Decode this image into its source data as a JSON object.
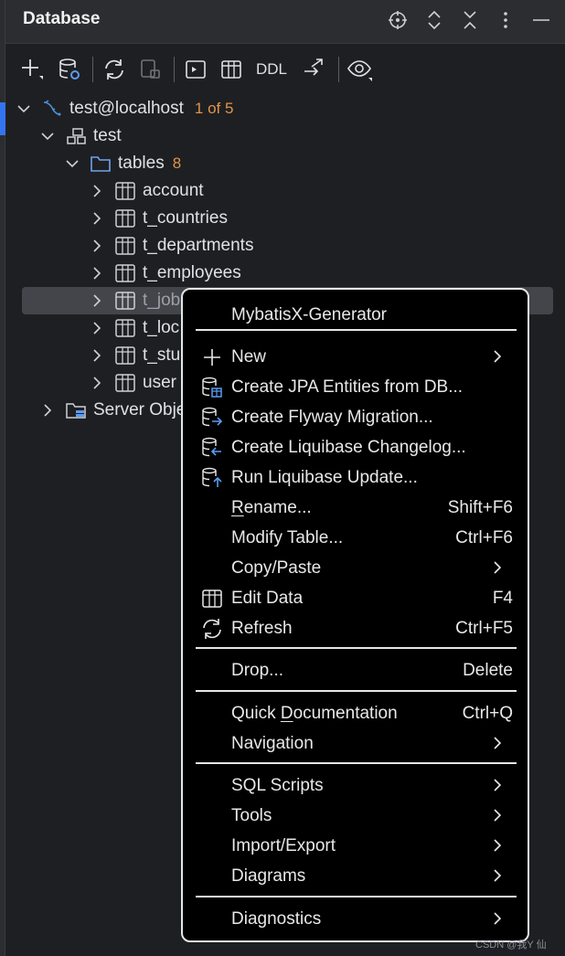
{
  "header": {
    "title": "Database",
    "icons": [
      "locate-icon",
      "expand-collapse-icon",
      "collapse-all-icon",
      "more-icon",
      "minimize-icon"
    ]
  },
  "toolbar": {
    "buttons": [
      "add-icon",
      "data-source-properties-icon",
      "refresh-icon",
      "disconnect-icon",
      "console-icon",
      "table-icon",
      "ddl",
      "jump-icon",
      "view-options-icon"
    ],
    "ddl_label": "DDL"
  },
  "tree": {
    "connection": {
      "label": "test@localhost",
      "count": "1 of 5"
    },
    "schema": {
      "label": "test"
    },
    "tables_folder": {
      "label": "tables",
      "count": "8"
    },
    "tables": [
      {
        "label": "account"
      },
      {
        "label": "t_countries"
      },
      {
        "label": "t_departments"
      },
      {
        "label": "t_employees"
      },
      {
        "label": "t_job"
      },
      {
        "label": "t_loc"
      },
      {
        "label": "t_stu"
      },
      {
        "label": "user"
      }
    ],
    "server_objects": {
      "label": "Server Obje"
    }
  },
  "menu": {
    "items": [
      {
        "label": "MybatisX-Generator",
        "shortcut": ""
      },
      {
        "label": "New",
        "shortcut": ""
      },
      {
        "label": "Create JPA Entities from DB...",
        "shortcut": ""
      },
      {
        "label": "Create Flyway Migration...",
        "shortcut": ""
      },
      {
        "label": "Create Liquibase Changelog...",
        "shortcut": ""
      },
      {
        "label": "Run Liquibase Update...",
        "shortcut": ""
      },
      {
        "label_pre": "",
        "label_u": "R",
        "label_post": "ename...",
        "shortcut": "Shift+F6"
      },
      {
        "label": "Modify Table...",
        "shortcut": "Ctrl+F6"
      },
      {
        "label": "Copy/Paste",
        "shortcut": ""
      },
      {
        "label": "Edit Data",
        "shortcut": "F4"
      },
      {
        "label": "Refresh",
        "shortcut": "Ctrl+F5"
      },
      {
        "label": "Drop...",
        "shortcut": "Delete"
      },
      {
        "label_pre": "Quick ",
        "label_u": "D",
        "label_post": "ocumentation",
        "shortcut": "Ctrl+Q"
      },
      {
        "label": "Navigation",
        "shortcut": ""
      },
      {
        "label": "SQL Scripts",
        "shortcut": ""
      },
      {
        "label": "Tools",
        "shortcut": ""
      },
      {
        "label": "Import/Export",
        "shortcut": ""
      },
      {
        "label": "Diagrams",
        "shortcut": ""
      },
      {
        "label": "Diagnostics",
        "shortcut": ""
      }
    ]
  },
  "watermark": "CSDN @我Y   仙",
  "colors": {
    "panel_bg": "#1e1f22",
    "menu_bg": "#000000",
    "count_orange": "#e0944a",
    "selection": "#43454a",
    "accent_blue": "#3574f0"
  }
}
